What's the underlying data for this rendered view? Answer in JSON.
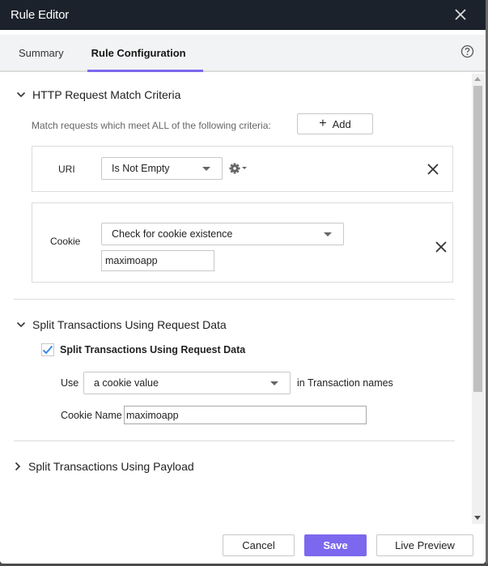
{
  "window": {
    "title": "Rule Editor"
  },
  "tabs": [
    {
      "label": "Summary",
      "active": false
    },
    {
      "label": "Rule Configuration",
      "active": true
    }
  ],
  "sections": {
    "match": {
      "title": "HTTP Request Match Criteria",
      "expanded": true,
      "hint": "Match requests which meet ALL of the following criteria:",
      "add_label": "Add",
      "criteria": [
        {
          "label": "URI",
          "operator": "Is Not Empty",
          "value": null
        },
        {
          "label": "Cookie",
          "operator": "Check for cookie existence",
          "value": "maximoapp"
        }
      ]
    },
    "split_request": {
      "title": "Split Transactions Using Request Data",
      "expanded": true,
      "checkbox_label": "Split Transactions Using Request Data",
      "checked": true,
      "use_label": "Use",
      "use_value": "a cookie value",
      "suffix_label": "in Transaction names",
      "cookie_name_label": "Cookie Name",
      "cookie_name_value": "maximoapp"
    },
    "split_payload": {
      "title": "Split Transactions Using Payload",
      "expanded": false
    }
  },
  "footer": {
    "cancel_label": "Cancel",
    "save_label": "Save",
    "preview_label": "Live Preview"
  },
  "colors": {
    "titlebar": "#1c222b",
    "accent": "#7b68ee",
    "checkmark": "#3b8be6"
  }
}
